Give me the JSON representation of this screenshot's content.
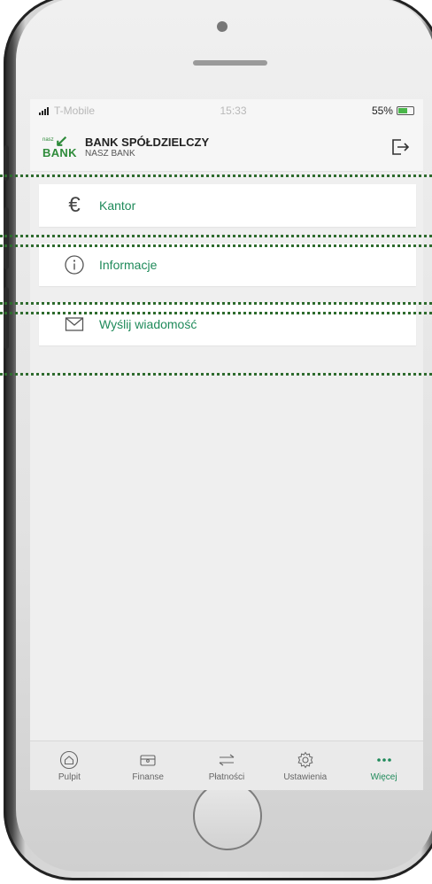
{
  "status": {
    "carrier": "T-Mobile",
    "time": "15:33",
    "battery": "55%"
  },
  "bank": {
    "logo_top": "nasz",
    "logo_main": "BANK",
    "name": "BANK SPÓŁDZIELCZY",
    "subname": "NASZ BANK"
  },
  "menu": {
    "items": [
      {
        "label": "Kantor",
        "icon": "euro-icon"
      },
      {
        "label": "Informacje",
        "icon": "info-icon"
      },
      {
        "label": "Wyślij wiadomość",
        "icon": "envelope-icon"
      }
    ]
  },
  "tabs": [
    {
      "label": "Pulpit",
      "icon": "home-icon"
    },
    {
      "label": "Finanse",
      "icon": "wallet-icon"
    },
    {
      "label": "Płatności",
      "icon": "transfer-icon"
    },
    {
      "label": "Ustawienia",
      "icon": "gear-icon"
    },
    {
      "label": "Więcej",
      "icon": "more-icon",
      "active": true
    }
  ],
  "colors": {
    "accent": "#1f8a5a",
    "brand": "#2e8b3a",
    "highlight_border": "#2e6b2e"
  }
}
